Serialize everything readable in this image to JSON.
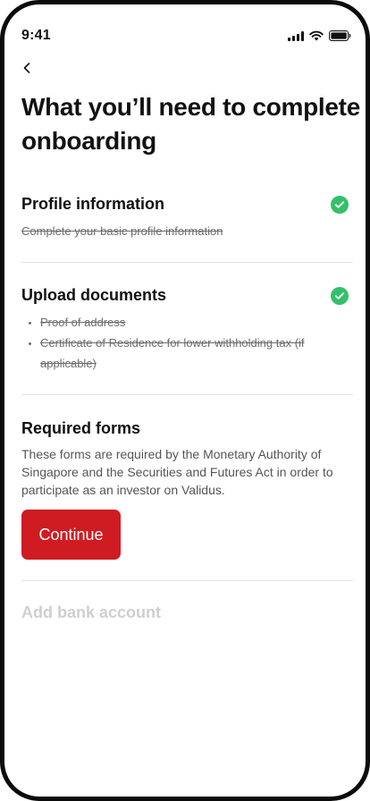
{
  "status_bar": {
    "time": "9:41"
  },
  "page": {
    "title": "What you’ll need to complete onboarding"
  },
  "sections": {
    "profile": {
      "title": "Profile information",
      "subtitle": "Complete your basic profile information",
      "completed": true
    },
    "documents": {
      "title": "Upload documents",
      "items": [
        "Proof of address",
        "Certificate of Residence for lower withholding tax (if applicable)"
      ],
      "completed": true
    },
    "forms": {
      "title": "Required forms",
      "description": "These forms are required by the Monetary Authority of Singapore and the Securities and Futures Act in order to participate as an investor on Validus.",
      "button_label": "Continue"
    },
    "bank": {
      "title": "Add bank account",
      "disabled": true
    }
  },
  "colors": {
    "accent": "#cf1b22",
    "success": "#34c06a",
    "disabled_text": "#cfcfcf"
  },
  "icons": [
    "back-icon",
    "check-icon",
    "signal-icon",
    "wifi-icon",
    "battery-icon"
  ]
}
